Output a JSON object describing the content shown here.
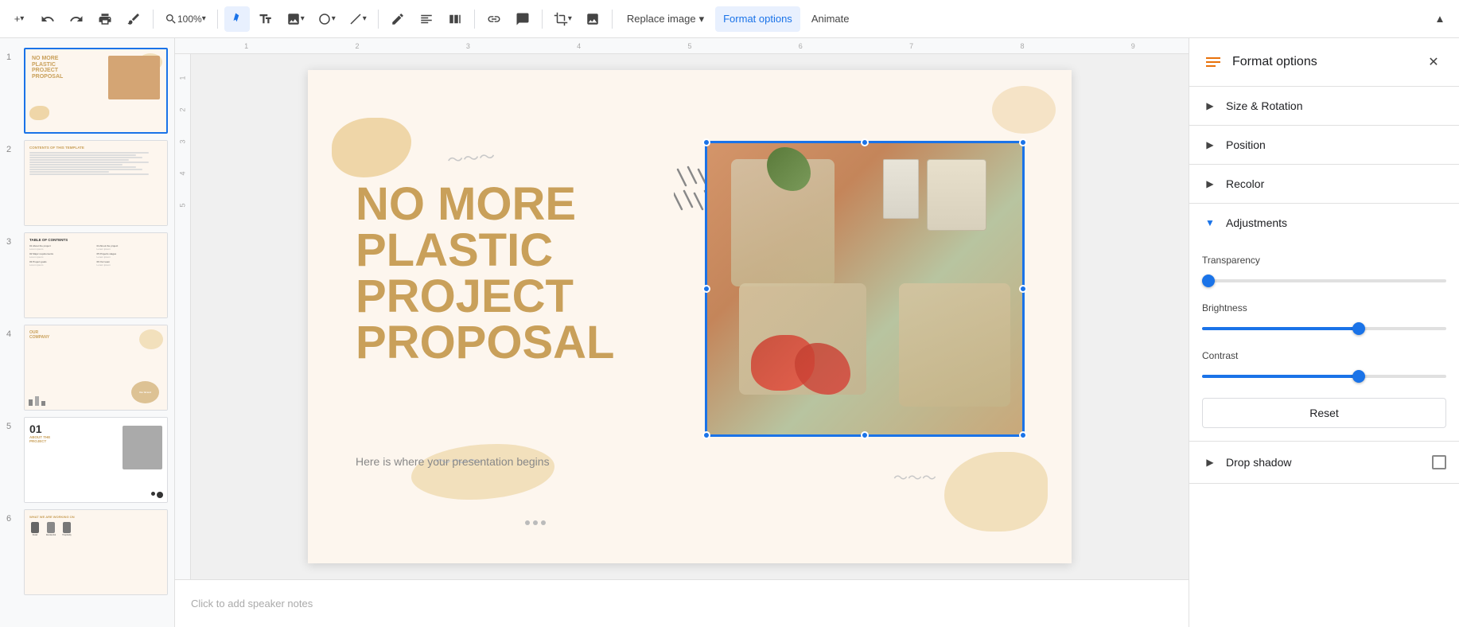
{
  "toolbar": {
    "add_label": "+",
    "undo_label": "↺",
    "redo_label": "↻",
    "print_label": "🖨",
    "paint_label": "🎨",
    "zoom_label": "100%",
    "cursor_label": "↖",
    "textbox_label": "T",
    "image_label": "🖼",
    "shape_label": "○",
    "line_label": "/",
    "pen_label": "✏",
    "align_label": "≡",
    "table_label": "⊞",
    "link_label": "🔗",
    "comment_label": "💬",
    "crop_label": "⛶",
    "replace_image_label": "Replace image",
    "replace_image_arrow": "▾",
    "format_options_label": "Format options",
    "animate_label": "Animate",
    "collapse_label": "▲"
  },
  "slides": [
    {
      "num": "1",
      "selected": true
    },
    {
      "num": "2",
      "selected": false
    },
    {
      "num": "3",
      "selected": false
    },
    {
      "num": "4",
      "selected": false
    },
    {
      "num": "5",
      "selected": false
    },
    {
      "num": "6",
      "selected": false
    }
  ],
  "slide_content": {
    "title_line1": "NO MORE",
    "title_line2": "PLASTIC",
    "title_line3": "PROJECT",
    "title_line4": "PROPOSAL",
    "subtitle": "Here is where your presentation begins"
  },
  "ruler": {
    "marks": [
      "1",
      "2",
      "3",
      "4",
      "5",
      "6",
      "7",
      "8",
      "9"
    ],
    "v_marks": [
      "1",
      "2",
      "3",
      "4",
      "5"
    ]
  },
  "speaker_notes": {
    "placeholder": "Click to add speaker notes"
  },
  "format_panel": {
    "title": "Format options",
    "icon": "⬡",
    "close_label": "×",
    "sections": {
      "size_rotation": "Size & Rotation",
      "position": "Position",
      "recolor": "Recolor",
      "adjustments": "Adjustments",
      "drop_shadow": "Drop shadow"
    },
    "adjustments": {
      "transparency_label": "Transparency",
      "transparency_value": 0,
      "brightness_label": "Brightness",
      "brightness_value": 65,
      "contrast_label": "Contrast",
      "contrast_value": 65
    },
    "reset_label": "Reset"
  }
}
